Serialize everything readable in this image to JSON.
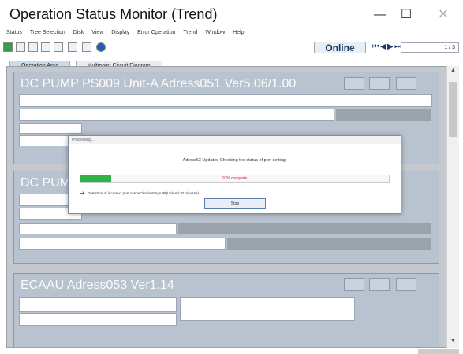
{
  "window": {
    "title": "Operation Status Monitor (Trend)",
    "min_label": "—",
    "max_label": "☐",
    "close_label": "✕"
  },
  "menu": [
    "Status",
    "Tree Selection",
    "Disk",
    "View",
    "Display",
    "Error Operation",
    "Trend",
    "Window",
    "Help"
  ],
  "toolbar": {
    "online_label": "Online",
    "nav": [
      "⏮",
      "◀",
      "▶",
      "⏭"
    ],
    "page": "1 / 3"
  },
  "tabs": [
    "Operation Area",
    "Multipoint Circuit Diagram"
  ],
  "panels": [
    {
      "title": "DC PUMP PS009 Unit-A Adress051 Ver5.06/1.00"
    },
    {
      "title": "DC PUMP"
    },
    {
      "title": "ECAAU Adress053 Ver1.14"
    }
  ],
  "dialog": {
    "header": "Processing...",
    "message": "Adress63 Updated Checking the status of port setting.",
    "progress_pct": 10,
    "progress_label": "10% complete",
    "warning": "Detection of incorrect port connection/settings 99(Upload 30 minutes)",
    "ok_label": "Stop"
  }
}
